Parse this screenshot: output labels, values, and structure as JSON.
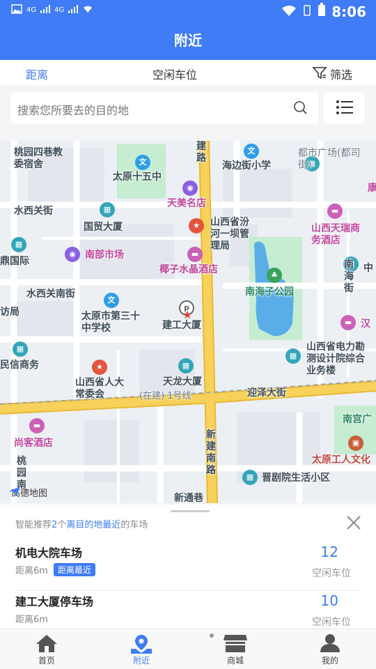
{
  "status": {
    "time": "8:06",
    "signal1": "4G",
    "signal2": "4G",
    "battery_glyph": "▮"
  },
  "header": {
    "title": "附近"
  },
  "tabs": [
    {
      "label": "距离",
      "active": true
    },
    {
      "label": "空闲车位",
      "active": false
    }
  ],
  "filter_label": "筛选",
  "search": {
    "placeholder": "搜索您所要去的目的地"
  },
  "map": {
    "pois": [
      "桃园四巷教委宿舍",
      "太原十五中",
      "海边街小学",
      "都市广场(都司街)",
      "康",
      "天美名店",
      "水西关街",
      "国贸大厦",
      "山西省汾河一坝管理局",
      "山西天瑞商务酒店",
      "南部市场",
      "鼎国际",
      "椰子水晶酒店",
      "南海子公园",
      "南海街",
      "中",
      "水西关南街",
      "太原市第三十中学校",
      "建工大厦",
      "访局",
      "汉",
      "民信商务",
      "山西省电力勘测设计院综合业务楼",
      "山西省人大常委会",
      "天龙大厦",
      "迎泽大街",
      "(在建) 1号线",
      "南宫广",
      "尚客酒店",
      "新建南路",
      "太原工人文化",
      "桃园南",
      "晋剧院生活小区",
      "新通巷",
      "建路"
    ],
    "logo": "高德地图"
  },
  "sheet": {
    "rec_prefix": "智能推荐",
    "rec_count": "2",
    "rec_mid": "个",
    "rec_highlight": "离目的地最近",
    "rec_suffix": "的车场",
    "items": [
      {
        "name": "机电大院车场",
        "distance": "距离6m",
        "badge": "距离最近",
        "free": "12",
        "free_label": "空闲车位"
      },
      {
        "name": "建工大厦停车场",
        "distance": "距离6m",
        "badge": "",
        "free": "10",
        "free_label": "空闲车位"
      }
    ]
  },
  "nav": [
    {
      "label": "首页",
      "icon": "home-icon"
    },
    {
      "label": "附近",
      "icon": "location-icon"
    },
    {
      "label": "商城",
      "icon": "shop-icon"
    },
    {
      "label": "我的",
      "icon": "user-icon"
    }
  ],
  "colors": {
    "accent": "#3f7cf5",
    "road_yellow": "#f7d15a",
    "park_green": "#c6ecd2",
    "water": "#5aaee8"
  }
}
